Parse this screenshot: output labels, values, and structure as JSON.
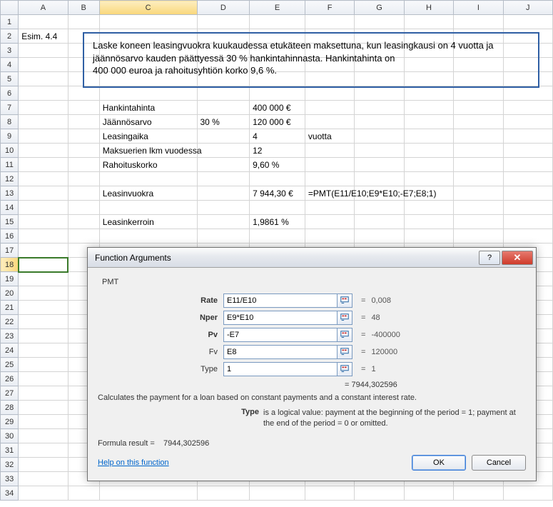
{
  "columns": [
    "A",
    "B",
    "C",
    "D",
    "E",
    "F",
    "G",
    "H",
    "I",
    "J"
  ],
  "rows": 34,
  "active_cell": "A18",
  "selected_col": "C",
  "cells": {
    "A2": "Esim. 4.4",
    "C7": "Hankintahinta",
    "E7": "400 000 €",
    "C8": "Jäännösarvo",
    "D8": "30 %",
    "E8": "120 000 €",
    "C9": "Leasingaika",
    "E9": "4",
    "F9": "vuotta",
    "C10": "Maksuerien lkm vuodessa",
    "E10": "12",
    "C11": "Rahoituskorko",
    "E11": "9,60 %",
    "C13": "Leasinvuokra",
    "E13": "7 944,30 €",
    "F13": "=PMT(E11/E10;E9*E10;-E7;E8;1)",
    "C15": "Leasinkerroin",
    "E15": "1,9861 %"
  },
  "bluebox": {
    "line1": "Laske koneen leasingvuokra kuukaudessa etukäteen maksettuna, kun leasingkausi on 4 vuotta ja jäännösarvo kauden päättyessä 30 % hankintahinnasta. Hankintahinta on",
    "line2": "400 000 euroa ja rahoitusyhtiön korko 9,6 %."
  },
  "dialog": {
    "title": "Function Arguments",
    "fn": "PMT",
    "args": [
      {
        "label": "Rate",
        "value": "E11/E10",
        "result": "0,008",
        "bold": true
      },
      {
        "label": "Nper",
        "value": "E9*E10",
        "result": "48",
        "bold": true
      },
      {
        "label": "Pv",
        "value": "-E7",
        "result": "-400000",
        "bold": true
      },
      {
        "label": "Fv",
        "value": "E8",
        "result": "120000",
        "bold": false
      },
      {
        "label": "Type",
        "value": "1",
        "result": "1",
        "bold": false
      }
    ],
    "overall_eq": "= ",
    "overall_result": "7944,302596",
    "description": "Calculates the payment for a loan based on constant payments and a constant interest rate.",
    "argdesc_label": "Type",
    "argdesc_text": "is a logical value: payment at the beginning of the period = 1; payment at the end of the period = 0 or omitted.",
    "formula_result_label": "Formula result =",
    "formula_result_value": "7944,302596",
    "help_link": "Help on this function",
    "ok": "OK",
    "cancel": "Cancel",
    "help_btn": "?",
    "close_btn": "✕"
  }
}
